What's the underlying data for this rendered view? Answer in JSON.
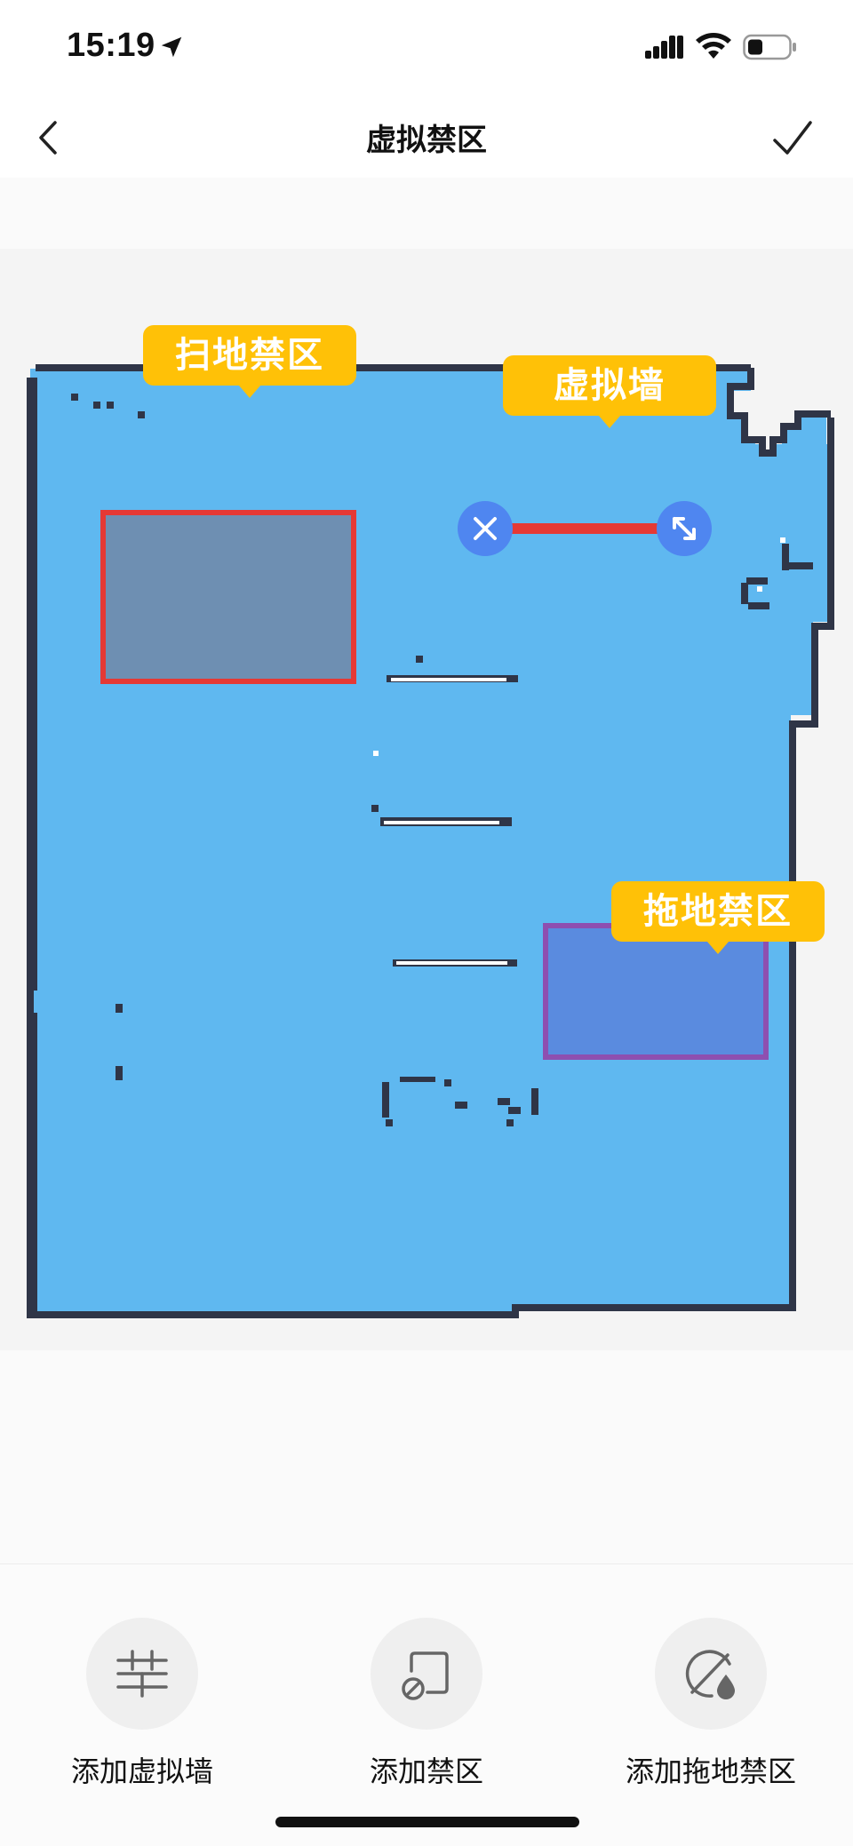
{
  "status_bar": {
    "time": "15:19",
    "icons": [
      "location-arrow-icon",
      "signal-icon",
      "wifi-icon",
      "battery-icon"
    ]
  },
  "nav": {
    "title": "虚拟禁区",
    "back_icon": "chevron-left-icon",
    "confirm_icon": "checkmark-icon"
  },
  "map": {
    "floor_color": "#5FB8F0",
    "wall_color": "#2F3547",
    "labels": {
      "sweep_zone": "扫地禁区",
      "virtual_wall": "虚拟墙",
      "mop_zone": "拖地禁区"
    },
    "zone_colors": {
      "sweep_zone_border": "#E53935",
      "sweep_zone_fill": "#6E8FB2",
      "mop_zone_border": "#8E4FB0",
      "mop_zone_fill": "#5A8BDF",
      "virtual_wall_line": "#E53935",
      "handle": "#4F86F0",
      "callout": "#FFC107"
    },
    "wall_handles": [
      "delete-icon",
      "resize-icon"
    ]
  },
  "toolbar": {
    "items": [
      {
        "label": "添加虚拟墙",
        "icon": "virtual-wall-icon"
      },
      {
        "label": "添加禁区",
        "icon": "no-go-zone-icon"
      },
      {
        "label": "添加拖地禁区",
        "icon": "no-mop-zone-icon"
      }
    ]
  }
}
